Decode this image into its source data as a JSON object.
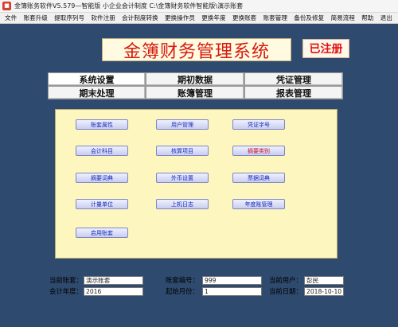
{
  "window": {
    "title": "金簿账务软件V5.579—智能版 小企业会计制度   C:\\金簿财务软件智能版\\演示账套",
    "icon": "app-logo-icon"
  },
  "menu": [
    "文件",
    "账套升级",
    "提取序列号",
    "软件注册",
    "会计制度转换",
    "更换操作员",
    "更换年度",
    "更换账套",
    "账套管理",
    "备份及修复",
    "简易流程",
    "帮助",
    "退出"
  ],
  "header": {
    "title": "金簿财务管理系统",
    "registered": "已注册"
  },
  "tabs": [
    "系统设置",
    "期初数据",
    "凭证管理",
    "期末处理",
    "账簿管理",
    "报表管理"
  ],
  "active_tab": "系统设置",
  "buttons": [
    "账套属性",
    "用户管理",
    "凭证字号",
    "会计科目",
    "核算项目",
    "摘要类别",
    "摘要词典",
    "外币设置",
    "票据词典",
    "计量单位",
    "上机日志",
    "年度账管理",
    "启用账套"
  ],
  "status": {
    "current_account_label": "当前账套：",
    "current_account_value": "演示账套",
    "account_no_label": "账套编号：",
    "account_no_value": "999",
    "current_user_label": "当前用户：",
    "current_user_value": "彭民",
    "fiscal_year_label": "会计年度：",
    "fiscal_year_value": "2016",
    "start_month_label": "起始月份：",
    "start_month_value": "1",
    "current_date_label": "当前日期：",
    "current_date_value": "2018-10-10"
  },
  "colors": {
    "background": "#2e4a6e",
    "panel": "#fdf6bf",
    "title_red": "#d61c10",
    "button_text": "#1a2bb8"
  }
}
